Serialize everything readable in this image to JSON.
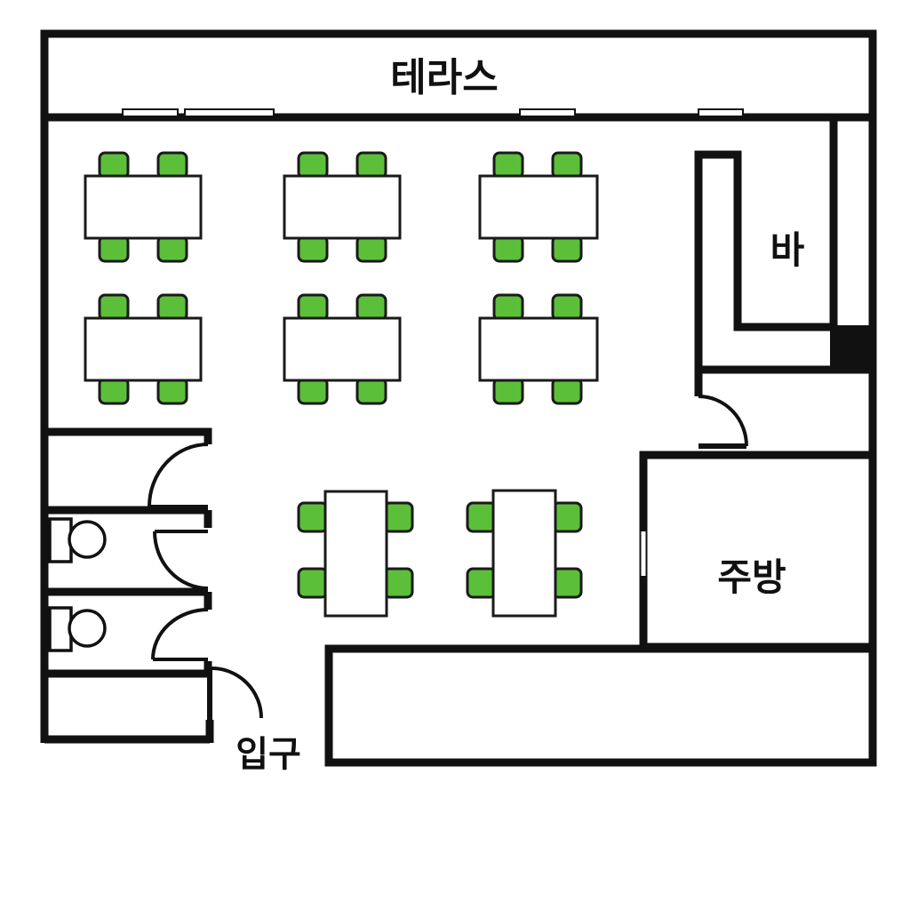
{
  "labels": {
    "terrace": "테라스",
    "bar": "바",
    "kitchen": "주방",
    "entrance": "입구"
  },
  "colors": {
    "wall": "#111111",
    "chair": "#5cbf3a",
    "chair_outline": "#1a1a1a",
    "table": "#ffffff",
    "background": "#ffffff"
  }
}
